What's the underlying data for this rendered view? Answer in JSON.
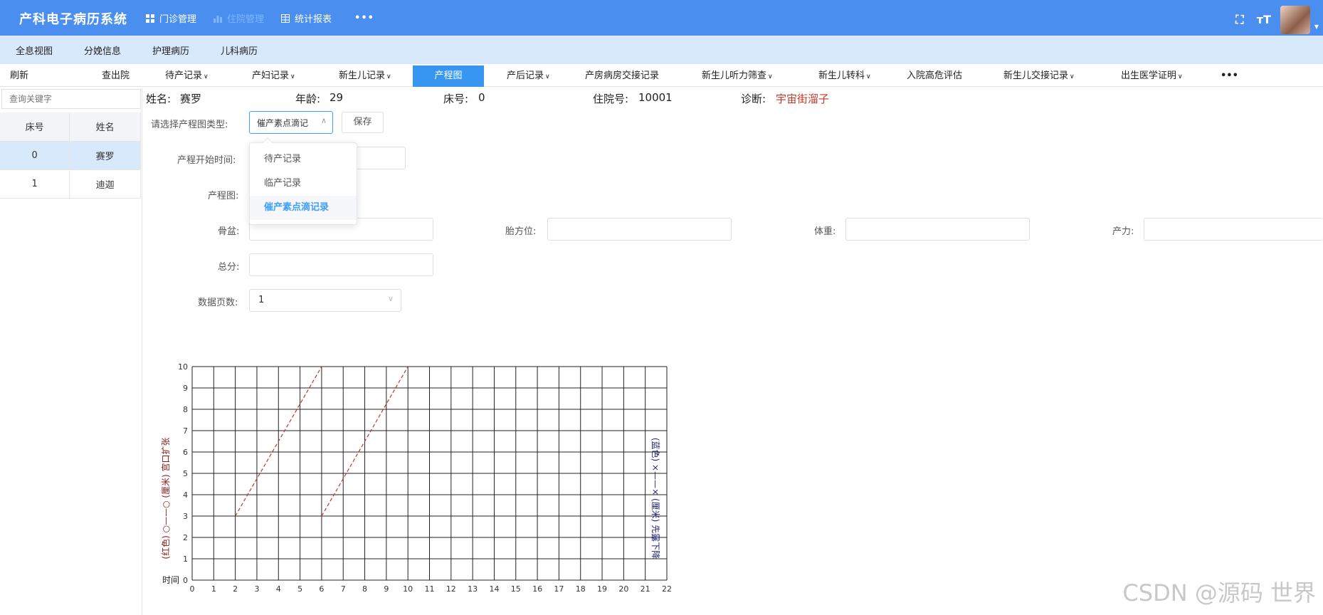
{
  "app": {
    "title": "产科电子病历系统",
    "topnav": [
      {
        "label": "门诊管理",
        "icon": "grid-icon"
      },
      {
        "label": "住院管理",
        "icon": "bar-chart-icon"
      },
      {
        "label": "统计报表",
        "icon": "table-icon"
      }
    ],
    "more": "•••"
  },
  "subnav": [
    "全息视图",
    "分娩信息",
    "护理病历",
    "儿科病历"
  ],
  "tabs": {
    "refresh": "刷新",
    "discharge": "查出院",
    "items": [
      {
        "label": "待产记录",
        "dropdown": true
      },
      {
        "label": "产妇记录",
        "dropdown": true
      },
      {
        "label": "新生儿记录",
        "dropdown": true
      },
      {
        "label": "产程图",
        "dropdown": false,
        "active": true
      },
      {
        "label": "产后记录",
        "dropdown": true
      },
      {
        "label": "产房病房交接记录",
        "dropdown": false
      },
      {
        "label": "新生儿听力筛查",
        "dropdown": true
      },
      {
        "label": "新生儿转科",
        "dropdown": true
      },
      {
        "label": "入院高危评估",
        "dropdown": false
      },
      {
        "label": "新生儿交接记录",
        "dropdown": true
      },
      {
        "label": "出生医学证明",
        "dropdown": true
      }
    ],
    "more": "•••"
  },
  "left": {
    "search_placeholder": "查询关键字",
    "headers": [
      "床号",
      "姓名"
    ],
    "rows": [
      {
        "bed": "0",
        "name": "赛罗",
        "selected": true
      },
      {
        "bed": "1",
        "name": "迪迦",
        "selected": false
      }
    ]
  },
  "patient": {
    "name_label": "姓名:",
    "name": "赛罗",
    "age_label": "年龄:",
    "age": "29",
    "bed_label": "床号:",
    "bed": "0",
    "admission_label": "住院号:",
    "admission": "10001",
    "diagnosis_label": "诊断:",
    "diagnosis": "宇宙街溜子"
  },
  "form": {
    "type_label": "请选择产程图类型:",
    "type_value": "催产素点滴记",
    "save": "保存",
    "start_label": "产程开始时间:",
    "chart_label": "产程图:",
    "pelvis_label": "骨盆:",
    "fetal_label": "胎方位:",
    "weight_label": "体重:",
    "power_label": "产力:",
    "score_label": "总分:",
    "pages_label": "数据页数:",
    "pages_value": "1",
    "dropdown_options": [
      "待产记录",
      "临产记录",
      "催产素点滴记录"
    ],
    "dropdown_selected": 2
  },
  "chart_data": {
    "type": "line",
    "x_ticks": [
      0,
      1,
      2,
      3,
      4,
      5,
      6,
      7,
      8,
      9,
      10,
      11,
      12,
      13,
      14,
      15,
      16,
      17,
      18,
      19,
      20,
      21,
      22
    ],
    "y_ticks": [
      0,
      1,
      2,
      3,
      4,
      5,
      6,
      7,
      8,
      9,
      10
    ],
    "xlim": [
      0,
      22
    ],
    "ylim": [
      0,
      10
    ],
    "grid": true,
    "x_axis_label": "时间",
    "left_axis_label": "(红色) ○——○ (厘米) 宫口扩张",
    "right_axis_label": "(蓝色) ×——× (厘米) 先露下降",
    "series": [
      {
        "x": [
          2,
          6
        ],
        "y": [
          3,
          10
        ],
        "color": "#c0392b",
        "style": "dashed"
      },
      {
        "x": [
          6,
          10
        ],
        "y": [
          3,
          10
        ],
        "color": "#c0392b",
        "style": "dashed"
      }
    ]
  },
  "watermark": "CSDN @源码 世界",
  "colors": {
    "topbar": "#4a8ef0",
    "subnav": "#d8e9fb",
    "active_tab": "#3797f0",
    "diagnosis": "#c0392b"
  }
}
